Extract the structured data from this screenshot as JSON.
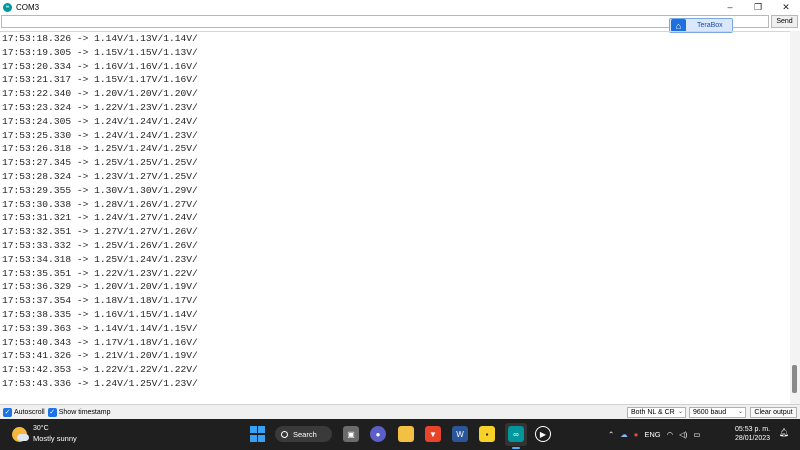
{
  "window": {
    "title": "COM3",
    "minimize": "–",
    "maximize": "❐",
    "close": "✕"
  },
  "send_row": {
    "input_value": "",
    "send_label": "Send"
  },
  "terabox": {
    "label": "TeraBox"
  },
  "serial_output": [
    "17:53:18.326 -> 1.14V/1.13V/1.14V/",
    "17:53:19.305 -> 1.15V/1.15V/1.13V/",
    "17:53:20.334 -> 1.16V/1.16V/1.16V/",
    "17:53:21.317 -> 1.15V/1.17V/1.16V/",
    "17:53:22.340 -> 1.20V/1.20V/1.20V/",
    "17:53:23.324 -> 1.22V/1.23V/1.23V/",
    "17:53:24.305 -> 1.24V/1.24V/1.24V/",
    "17:53:25.330 -> 1.24V/1.24V/1.23V/",
    "17:53:26.318 -> 1.25V/1.24V/1.25V/",
    "17:53:27.345 -> 1.25V/1.25V/1.25V/",
    "17:53:28.324 -> 1.23V/1.27V/1.25V/",
    "17:53:29.355 -> 1.30V/1.30V/1.29V/",
    "17:53:30.338 -> 1.28V/1.26V/1.27V/",
    "17:53:31.321 -> 1.24V/1.27V/1.24V/",
    "17:53:32.351 -> 1.27V/1.27V/1.26V/",
    "17:53:33.332 -> 1.25V/1.26V/1.26V/",
    "17:53:34.318 -> 1.25V/1.24V/1.23V/",
    "17:53:35.351 -> 1.22V/1.23V/1.22V/",
    "17:53:36.329 -> 1.20V/1.20V/1.19V/",
    "17:53:37.354 -> 1.18V/1.18V/1.17V/",
    "17:53:38.335 -> 1.16V/1.15V/1.14V/",
    "17:53:39.363 -> 1.14V/1.14V/1.15V/",
    "17:53:40.343 -> 1.17V/1.18V/1.16V/",
    "17:53:41.326 -> 1.21V/1.20V/1.19V/",
    "17:53:42.353 -> 1.22V/1.22V/1.22V/",
    "17:53:43.336 -> 1.24V/1.25V/1.23V/"
  ],
  "bottom_bar": {
    "autoscroll_label": "Autoscroll",
    "autoscroll_checked": true,
    "timestamp_label": "Show timestamp",
    "timestamp_checked": true,
    "line_ending": "Both NL & CR",
    "baud_rate": "9600 baud",
    "clear_label": "Clear output"
  },
  "taskbar": {
    "weather_temp": "30°C",
    "weather_desc": "Mostly sunny",
    "search_label": "Search",
    "language": "ENG",
    "time": "05:53 p. m.",
    "date": "28/01/2023"
  },
  "colors": {
    "accent": "#1a73e8",
    "arduino_teal": "#00979c",
    "taskbar_bg": "#1f1f1f"
  }
}
